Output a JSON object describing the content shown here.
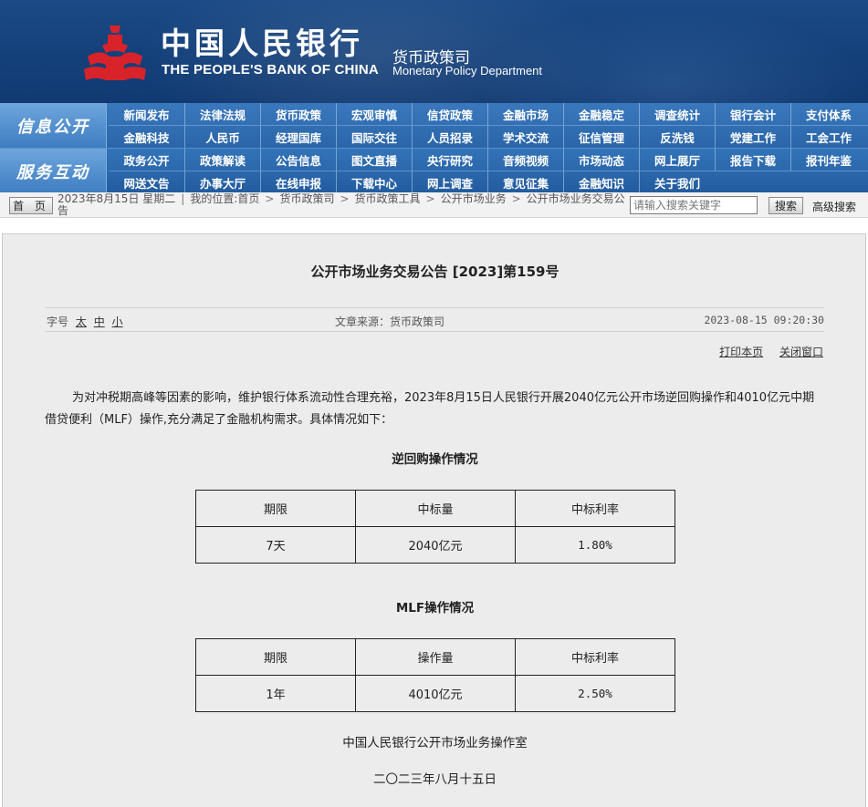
{
  "header": {
    "bank_name_cn": "中国人民银行",
    "bank_name_en": "THE PEOPLE'S BANK OF CHINA",
    "department_cn": "货币政策司",
    "department_en": "Monetary Policy Department",
    "brand_color": "#14407a",
    "emblem_color": "#d8232a",
    "emblem_icon": "pboc-emblem-icon"
  },
  "nav": {
    "groups": [
      {
        "label": "信息公开",
        "rows": [
          [
            "新闻发布",
            "法律法规",
            "货币政策",
            "宏观审慎",
            "信贷政策",
            "金融市场",
            "金融稳定",
            "调查统计",
            "银行会计",
            "支付体系"
          ],
          [
            "金融科技",
            "人民币",
            "经理国库",
            "国际交往",
            "人员招录",
            "学术交流",
            "征信管理",
            "反洗钱",
            "党建工作",
            "工会工作"
          ]
        ]
      },
      {
        "label": "服务互动",
        "rows": [
          [
            "政务公开",
            "政策解读",
            "公告信息",
            "图文直播",
            "央行研究",
            "音频视频",
            "市场动态",
            "网上展厅",
            "报告下载",
            "报刊年鉴"
          ],
          [
            "网送文告",
            "办事大厅",
            "在线申报",
            "下载中心",
            "网上调查",
            "意见征集",
            "金融知识",
            "关于我们"
          ]
        ]
      }
    ]
  },
  "crumbbar": {
    "home_label": "首 页",
    "date_text": "2023年8月15日 星期二",
    "location_prefix": "我的位置:",
    "crumbs": [
      "首页",
      "货币政策司",
      "货币政策工具",
      "公开市场业务",
      "公开市场业务交易公告"
    ],
    "search_placeholder": "请输入搜索关键字",
    "search_button": "搜索",
    "advanced_search": "高级搜索"
  },
  "article": {
    "title": "公开市场业务交易公告 [2023]第159号",
    "font_size_label": "字号",
    "font_sizes": [
      "太",
      "中",
      "小"
    ],
    "source": "文章来源：货币政策司",
    "datetime": "2023-08-15 09:20:30",
    "print_label": "打印本页",
    "close_label": "关闭窗口",
    "paragraph": "为对冲税期高峰等因素的影响，维护银行体系流动性合理充裕，2023年8月15日人民银行开展2040亿元公开市场逆回购操作和4010亿元中期借贷便利（MLF）操作,充分满足了金融机构需求。具体情况如下：",
    "reverse_repo": {
      "title": "逆回购操作情况",
      "headers": [
        "期限",
        "中标量",
        "中标利率"
      ],
      "row": [
        "7天",
        "2040亿元",
        "1.80%"
      ]
    },
    "mlf": {
      "title": "MLF操作情况",
      "headers": [
        "期限",
        "操作量",
        "中标利率"
      ],
      "row": [
        "1年",
        "4010亿元",
        "2.50%"
      ]
    },
    "signature": "中国人民银行公开市场业务操作室",
    "sign_date": "二〇二三年八月十五日"
  }
}
